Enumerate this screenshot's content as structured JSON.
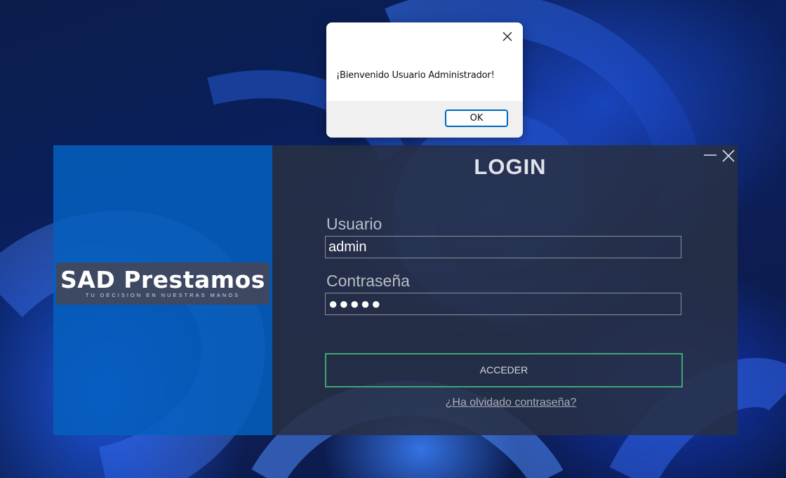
{
  "dialog": {
    "message": "¡Bienvenido Usuario Administrador!",
    "ok_label": "OK"
  },
  "login": {
    "title": "LOGIN",
    "usuario_label": "Usuario",
    "usuario_value": "admin",
    "password_label": "Contraseña",
    "password_value": "●●●●●",
    "submit_label": "ACCEDER",
    "forgot_label": "¿Ha olvidado contraseña?"
  },
  "brand": {
    "title": "SAD Prestamos",
    "subtitle": "TU DECISION EN NUESTRAS MANOS"
  },
  "colors": {
    "brand_panel": "#055fbe",
    "form_panel": "#283044",
    "submit_border": "#3ea578",
    "ok_border": "#0067c0"
  },
  "icons": {
    "minimize": "minimize-icon",
    "close": "close-icon",
    "dialog_close": "close-icon"
  }
}
